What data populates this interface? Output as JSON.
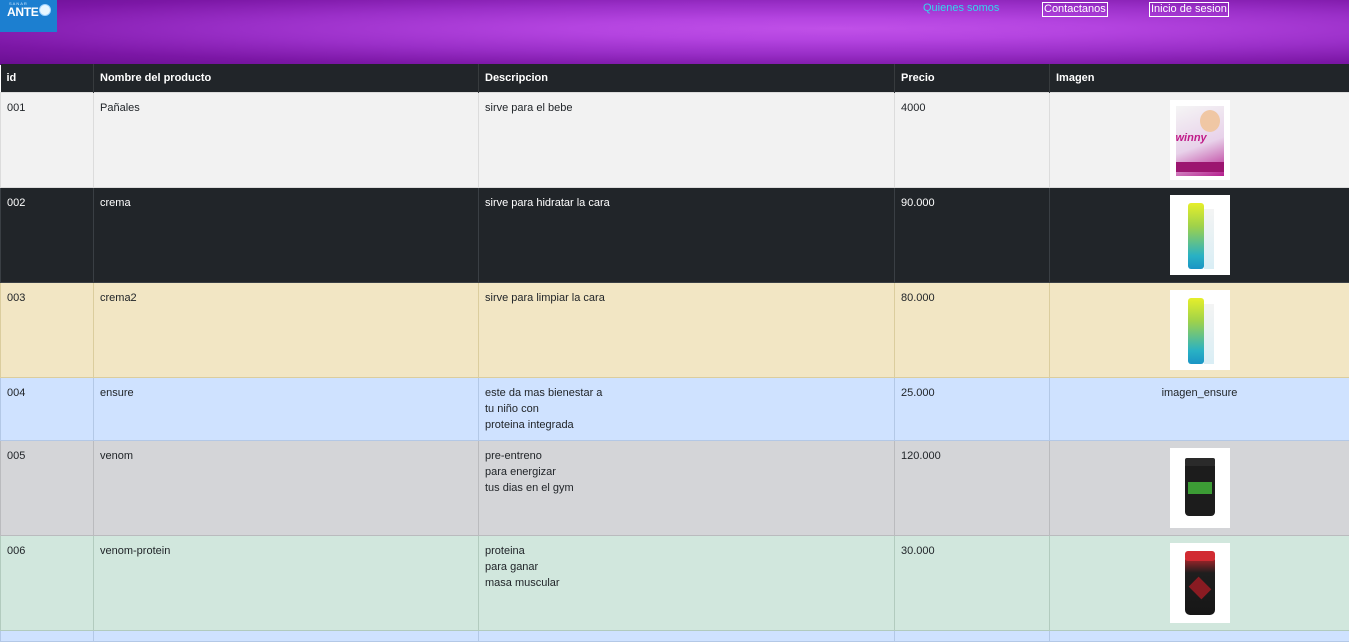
{
  "header": {
    "logo_small_text": "SANAR",
    "logo_text": "ANTE",
    "nav": {
      "quienes": "Quienes somos",
      "contactanos": "Contactanos",
      "login": "Inicio de sesion"
    }
  },
  "table": {
    "columns": [
      "id",
      "Nombre del producto",
      "Descripcion",
      "Precio",
      "Imagen"
    ],
    "rows": [
      {
        "id": "001",
        "name": "Pañales",
        "desc": [
          "sirve para el bebe"
        ],
        "price": "4000",
        "image": "diaper-package"
      },
      {
        "id": "002",
        "name": "crema",
        "desc": [
          "sirve para hidratar la cara"
        ],
        "price": "90.000",
        "image": "cream-tube"
      },
      {
        "id": "003",
        "name": "crema2",
        "desc": [
          "sirve para limpiar la cara"
        ],
        "price": "80.000",
        "image": "cream-tube"
      },
      {
        "id": "004",
        "name": "ensure",
        "desc": [
          "este da mas bienestar a",
          "tu niño con",
          "proteina integrada"
        ],
        "price": "25.000",
        "image_alt": "imagen_ensure"
      },
      {
        "id": "005",
        "name": "venom",
        "desc": [
          "pre-entreno",
          "para energizar",
          "tus dias en el gym"
        ],
        "price": "120.000",
        "image": "supplement-jar"
      },
      {
        "id": "006",
        "name": "venom-protein",
        "desc": [
          "proteina",
          "para ganar",
          "masa muscular"
        ],
        "price": "30.000",
        "image": "protein-jar"
      }
    ]
  },
  "colors": {
    "header_gradient": [
      "#6a0f92",
      "#c050e8"
    ],
    "table_head": "#212529",
    "row_light": "#f2f2f2",
    "row_dark": "#212529",
    "row_warning": "#f2e6c4",
    "row_primary": "#cfe2ff",
    "row_secondary": "#d4d5d8",
    "row_success": "#d1e7dd",
    "nav_link": "#34d6ee"
  }
}
